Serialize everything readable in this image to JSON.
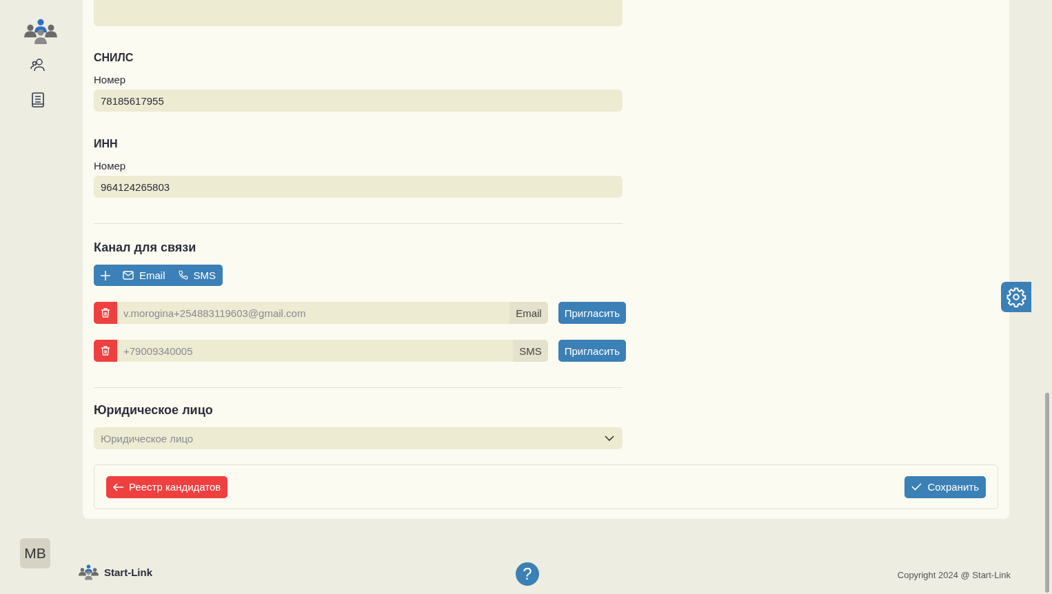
{
  "sidebar": {
    "avatar": "MB"
  },
  "sections": [
    {
      "title": "СНИЛС",
      "label": "Номер",
      "value": "78185617955"
    },
    {
      "title": "ИНН",
      "label": "Номер",
      "value": "964124265803"
    }
  ],
  "contact": {
    "title": "Канал для связи",
    "add_buttons": [
      {
        "kind": "email",
        "label": "Email"
      },
      {
        "kind": "sms",
        "label": "SMS"
      }
    ],
    "rows": [
      {
        "value": "v.morogina+254883119603@gmail.com",
        "disabled": true,
        "channel": "Email",
        "button": "Пригласить"
      },
      {
        "value": "+79009340005",
        "disabled": true,
        "channel": "SMS",
        "button": "Пригласить"
      }
    ]
  },
  "legal_entity": {
    "title": "Юридическое лицо",
    "placeholder": "Юридическое лицо"
  },
  "actions": {
    "back": "Реестр кандидатов",
    "save": "Сохранить"
  },
  "footer": {
    "brand": "Start-Link",
    "help": "?",
    "copyright": "Copyright 2024 @ Start-Link"
  }
}
